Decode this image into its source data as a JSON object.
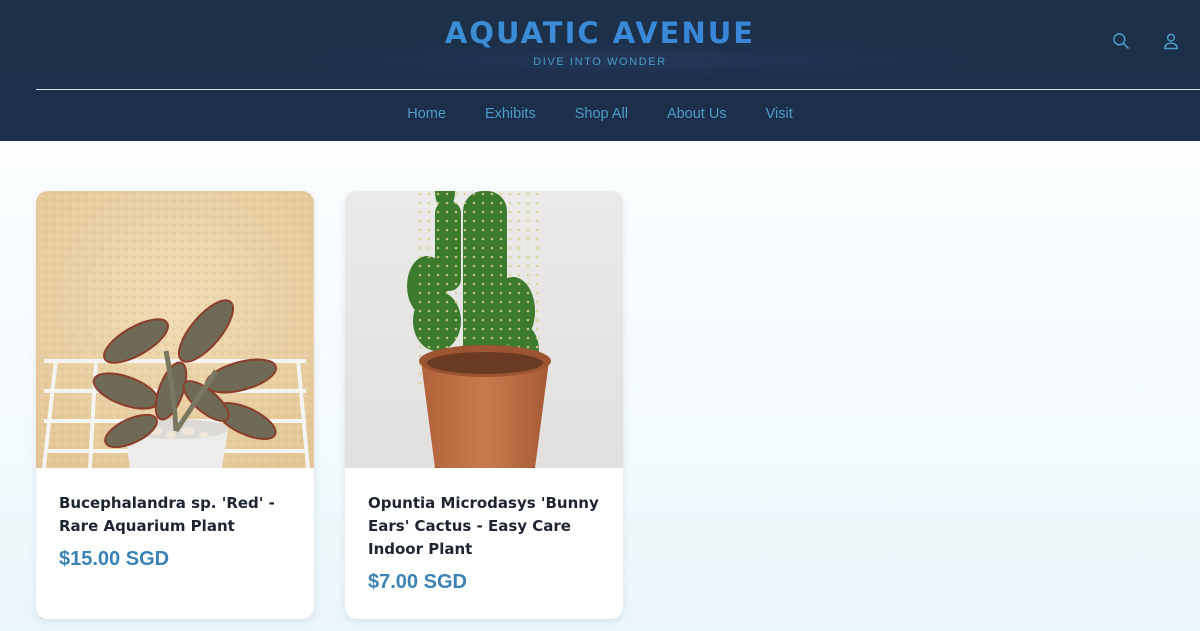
{
  "brand": {
    "title": "AQUATIC AVENUE",
    "tagline": "DIVE INTO WONDER"
  },
  "header": {
    "icons": {
      "search": "search-icon",
      "account": "account-icon"
    }
  },
  "nav": {
    "items": [
      {
        "label": "Home"
      },
      {
        "label": "Exhibits"
      },
      {
        "label": "Shop All"
      },
      {
        "label": "About Us"
      },
      {
        "label": "Visit"
      }
    ]
  },
  "products": [
    {
      "title": "Bucephalandra sp. 'Red' - Rare Aquarium Plant",
      "price": "$15.00 SGD",
      "image": "succulent-plant-photo"
    },
    {
      "title": "Opuntia Microdasys 'Bunny Ears' Cactus - Easy Care Indoor Plant",
      "price": "$7.00 SGD",
      "image": "cactus-in-pot-photo"
    }
  ],
  "colors": {
    "header_bg": "#1c3049",
    "accent": "#3b82b5",
    "nav_text": "#4f9cc6"
  }
}
